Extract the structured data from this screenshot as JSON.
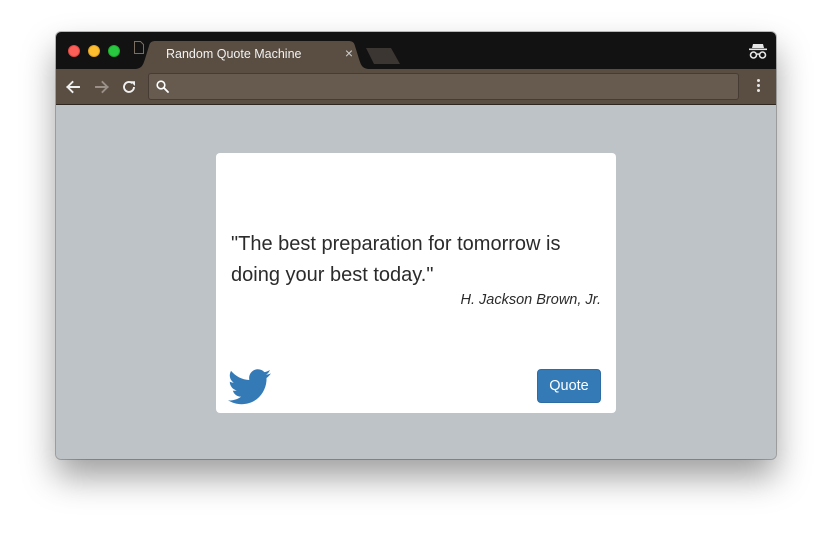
{
  "browser": {
    "tab": {
      "title": "Random Quote Machine",
      "close_symbol": "×",
      "favicon": "page-icon"
    },
    "new_tab_icon": "new-tab-icon",
    "incognito_icon": "incognito-icon",
    "toolbar": {
      "back_icon": "back-arrow-icon",
      "forward_icon": "forward-arrow-icon",
      "reload_icon": "reload-icon",
      "search_icon": "search-icon",
      "address_value": "",
      "menu_icon": "more-vert-icon"
    }
  },
  "colors": {
    "page_background": "#bdc3c7",
    "card_background": "#ffffff",
    "quote_button": "#337ab7",
    "twitter_icon": "#337ab7",
    "titlebar": "#121212",
    "toolbar": "#5a4e43"
  },
  "quote": {
    "text": "\"The best preparation for tomorrow is doing your best today.\"",
    "author": "H. Jackson Brown, Jr."
  },
  "actions": {
    "tweet_icon": "twitter-icon",
    "quote_button_label": "Quote"
  }
}
